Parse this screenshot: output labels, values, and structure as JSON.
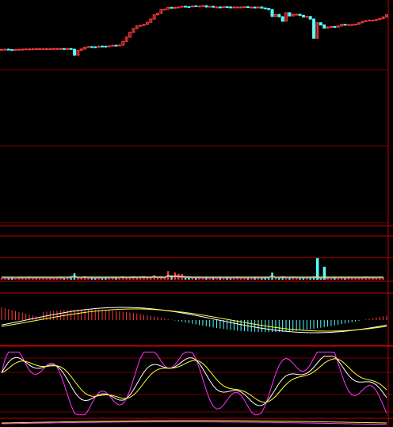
{
  "chart_data": [
    {
      "type": "candlestick",
      "panel": "price",
      "colors": {
        "up": "#ff3b3b",
        "down": "#54ffff",
        "grid": "#7a0000",
        "axis": "#c00000"
      },
      "close": [
        59.4,
        59.6,
        59.2,
        59.0,
        59.3,
        59.5,
        59.6,
        59.8,
        59.8,
        59.9,
        60.0,
        60.0,
        60.0,
        60.0,
        60.0,
        60.2,
        60.2,
        60.2,
        60.1,
        60.2,
        59.6,
        54.0,
        58.5,
        59.8,
        61.5,
        62.0,
        61.8,
        61.5,
        62.5,
        62.4,
        62.2,
        62.7,
        63.3,
        63.0,
        63.5,
        67.0,
        71.0,
        75.5,
        79.0,
        81.5,
        82.0,
        83.0,
        85.0,
        88.0,
        92.0,
        93.5,
        97.0,
        97.3,
        99.0,
        98.5,
        99.0,
        99.3,
        100.0,
        99.7,
        99.5,
        100.4,
        100.2,
        100.2,
        100.6,
        99.4,
        100.0,
        99.2,
        99.3,
        99.1,
        99.6,
        99.3,
        99.0,
        99.3,
        99.3,
        99.3,
        99.6,
        99.0,
        99.2,
        99.1,
        99.3,
        98.4,
        98.0,
        97.0,
        90.5,
        92.3,
        90.2,
        86.0,
        94.0,
        91.0,
        92.5,
        92.5,
        91.5,
        90.0,
        90.4,
        88.0,
        70.0,
        84.5,
        82.5,
        79.5,
        80.5,
        81.0,
        80.5,
        81.5,
        83.0,
        82.5,
        82.8,
        82.8,
        83.2,
        84.5,
        85.8,
        86.5,
        87.0,
        87.0,
        87.5,
        88.5,
        90.0,
        92.0
      ],
      "ylim": [
        0,
        100
      ]
    },
    {
      "type": "bar",
      "panel": "volume",
      "values": [
        1,
        1,
        0.8,
        1,
        0.7,
        0.9,
        1,
        0.8,
        1.2,
        1,
        0.9,
        1,
        1,
        0.8,
        0.9,
        0.8,
        1,
        1.2,
        0.8,
        1,
        2,
        4.5,
        1,
        1.2,
        2,
        1,
        1.1,
        0.9,
        1.3,
        1,
        1.2,
        1,
        1.5,
        1.2,
        1,
        2,
        1,
        1.5,
        2,
        1.5,
        1.7,
        2,
        1.5,
        1.5,
        3,
        1.5,
        2,
        1,
        6,
        3,
        5,
        4,
        4,
        2,
        2,
        1.5,
        1.5,
        1.5,
        1,
        1.5,
        1,
        1.5,
        1,
        1.5,
        1,
        1.5,
        1,
        1,
        1.5,
        1,
        1,
        1,
        1,
        1.5,
        1.2,
        1,
        1.2,
        1,
        5,
        1,
        1.3,
        2,
        1.5,
        1.3,
        1.5,
        1.3,
        1,
        1.2,
        1.2,
        1.3,
        2,
        1.5,
        1,
        1,
        1.2,
        1,
        1.2,
        1,
        1.5,
        1,
        1.2,
        1,
        1,
        1,
        1.2,
        1.5,
        1.3,
        1.2,
        1,
        1.3,
        1.5
      ],
      "highlight": [
        {
          "index": 91,
          "value": 15
        },
        {
          "index": 93,
          "value": 9
        }
      ],
      "ylim": [
        0,
        16
      ]
    },
    {
      "type": "bar+line",
      "panel": "macd",
      "ylim": [
        -1,
        1
      ]
    },
    {
      "type": "line",
      "panel": "kdj",
      "ylim": [
        0,
        100
      ]
    }
  ]
}
